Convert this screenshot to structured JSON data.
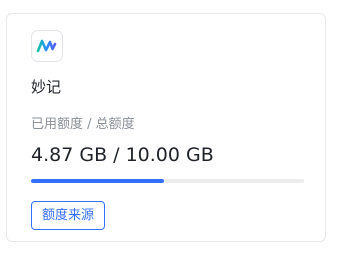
{
  "app": {
    "name": "妙记",
    "icon": "miaoji-waveform-icon"
  },
  "quota": {
    "label": "已用额度 / 总额度",
    "value_text": "4.87 GB / 10.00 GB",
    "used_gb": 4.87,
    "total_gb": 10.0,
    "used_fraction": 0.487
  },
  "actions": {
    "source_label": "额度来源"
  },
  "colors": {
    "accent": "#3370ff",
    "progress_track": "#ececec",
    "border": "#e6e8eb"
  }
}
